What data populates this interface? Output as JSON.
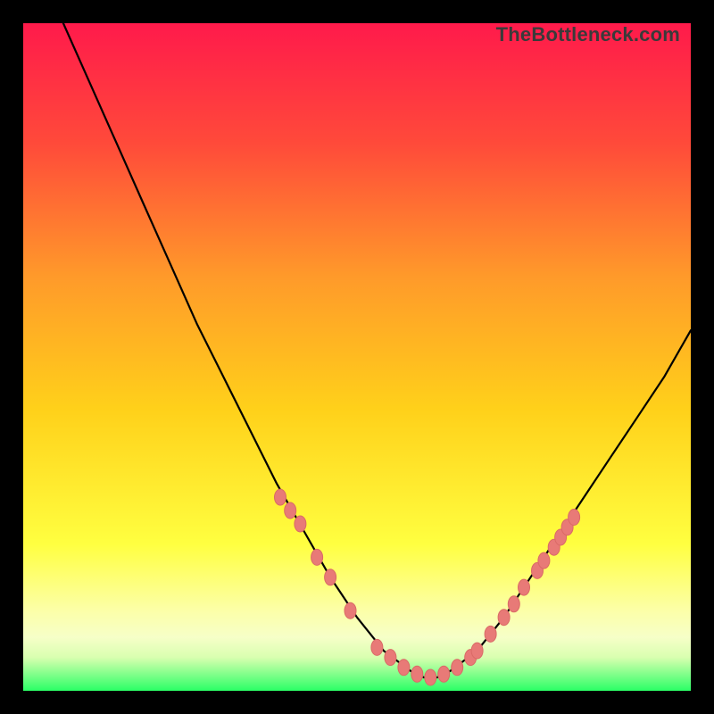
{
  "watermark": {
    "text": "TheBottleneck.com"
  },
  "chart_data": {
    "type": "line",
    "title": "",
    "xlabel": "",
    "ylabel": "",
    "xlim": [
      0,
      100
    ],
    "ylim": [
      0,
      100
    ],
    "grid": false,
    "legend": false,
    "series": [
      {
        "name": "curve",
        "x": [
          6,
          10,
          14,
          18,
          22,
          26,
          30,
          34,
          38,
          42,
          46,
          50,
          54,
          58,
          60,
          62,
          64,
          68,
          72,
          76,
          80,
          84,
          88,
          92,
          96,
          100
        ],
        "y": [
          100,
          91,
          82,
          73,
          64,
          55,
          47,
          39,
          31,
          24,
          17,
          11,
          6,
          3,
          2,
          2,
          3,
          6,
          11,
          17,
          23,
          29,
          35,
          41,
          47,
          54
        ]
      }
    ],
    "markers": {
      "name": "highlighted-points",
      "color": "#e87a77",
      "x": [
        38.5,
        40,
        41.5,
        44,
        46,
        49,
        53,
        55,
        57,
        59,
        61,
        63,
        65,
        67,
        68,
        70,
        72,
        73.5,
        75,
        77,
        78,
        79.5,
        80.5,
        81.5,
        82.5
      ],
      "y": [
        29,
        27,
        25,
        20,
        17,
        12,
        6.5,
        5,
        3.5,
        2.5,
        2,
        2.5,
        3.5,
        5,
        6,
        8.5,
        11,
        13,
        15.5,
        18,
        19.5,
        21.5,
        23,
        24.5,
        26
      ]
    },
    "colors": {
      "gradient_top": "#ff1a4b",
      "gradient_mid_upper": "#ff6a2a",
      "gradient_mid": "#ffd11a",
      "gradient_lower": "#ffff66",
      "gradient_band": "#fcffb0",
      "gradient_bottom": "#2bff66",
      "curve_stroke": "#000000",
      "marker_fill": "#e87a77"
    }
  }
}
